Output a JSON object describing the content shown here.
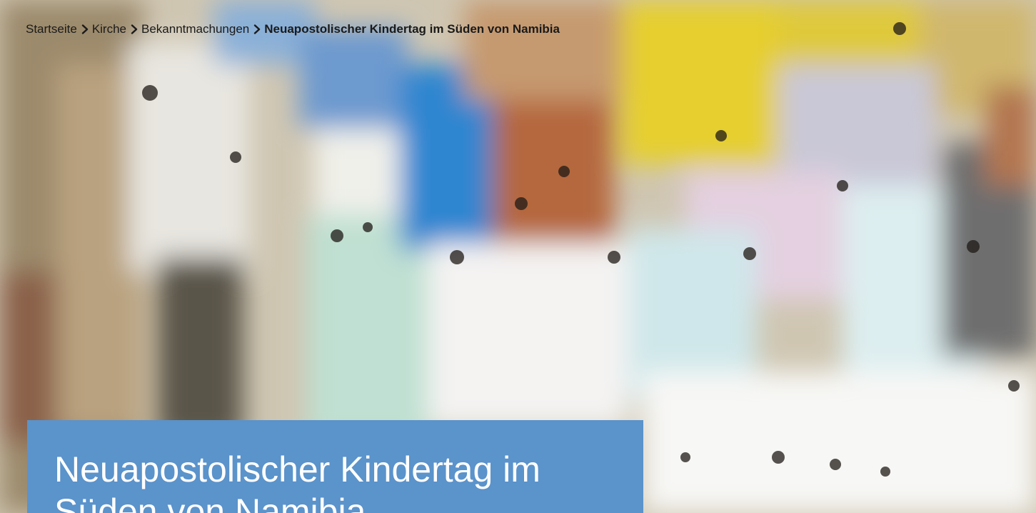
{
  "breadcrumb": {
    "items": [
      {
        "label": "Startseite"
      },
      {
        "label": "Kirche"
      },
      {
        "label": "Bekanntmachungen"
      }
    ],
    "current": "Neuapostolischer Kindertag im Süden von Namibia",
    "separator_icon": "chevron-right-icon"
  },
  "hero": {
    "image_icon": "photo",
    "title": "Neuapostolischer Kindertag im Süden von Namibia"
  },
  "colors": {
    "title_box_bg": "#5b93cb",
    "title_text": "#ffffff",
    "breadcrumb_text": "#1a1a1a"
  }
}
